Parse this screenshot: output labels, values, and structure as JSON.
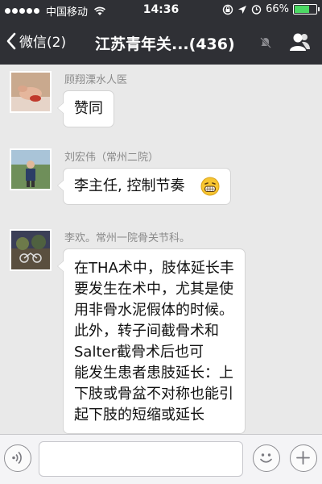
{
  "status_bar": {
    "carrier": "中国移动",
    "time": "14:36",
    "battery_percent_text": "66%",
    "battery_level": 0.66,
    "icons": [
      "signal-dots-icon",
      "wifi-icon",
      "lock-rotation-icon",
      "location-arrow-icon",
      "alarm-icon",
      "battery-icon"
    ]
  },
  "nav": {
    "back_label": "微信(2)",
    "title": "江苏青年关...(436)",
    "icons": [
      "chevron-left-icon",
      "mute-icon",
      "group-members-icon"
    ]
  },
  "messages": [
    {
      "sender": "顾翔溧水人医",
      "lines": [
        "赞同"
      ]
    },
    {
      "sender": "刘宏伟（常州二院）",
      "lines": [
        "李主任, 控制节奏"
      ],
      "emoji": "grin-emoji-icon"
    },
    {
      "sender": "李欢。常州一院骨关节科。",
      "lines": [
        "在THA术中，肢体延长丰",
        "要发生在术中，尤其是使",
        "用非骨水泥假体的时候。",
        "此外，转子间截骨术和",
        "Salter截骨术后也可",
        "能发生患者患肢延长：上",
        "下肢或骨盆不对称也能引",
        "起下肢的短缩或延长"
      ]
    }
  ],
  "input_bar": {
    "placeholder": "",
    "icons": [
      "voice-icon",
      "emoji-icon",
      "plus-icon"
    ]
  },
  "colors": {
    "header_bg": "#2f3035",
    "chat_bg": "#e9e9e9",
    "battery_green": "#4cd964"
  }
}
